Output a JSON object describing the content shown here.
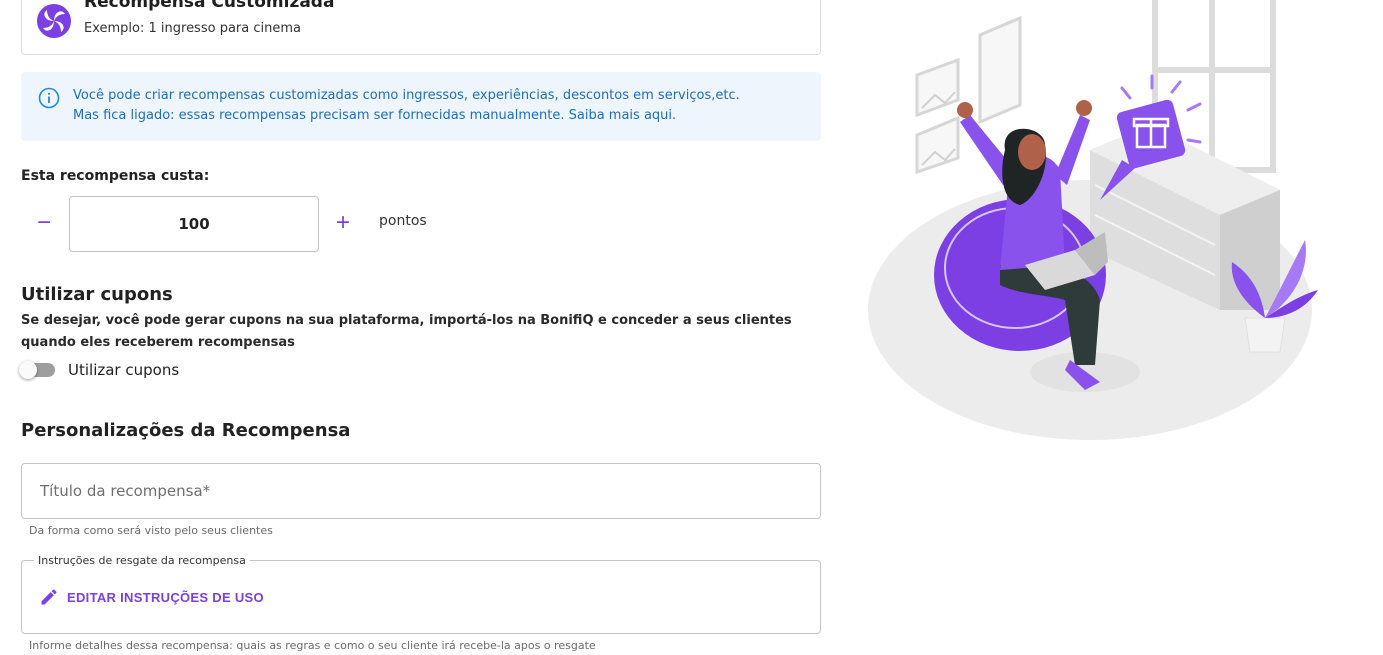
{
  "reward": {
    "title": "Recompensa Customizada",
    "subtitle": "Exemplo: 1 ingresso para cinema"
  },
  "info": {
    "line1": "Você pode criar recompensas customizadas como ingressos, experiências, descontos em serviços,etc.",
    "line2": "Mas fica ligado: essas recompensas precisam ser fornecidas manualmente. Saiba mais aqui."
  },
  "cost": {
    "label": "Esta recompensa custa:",
    "value": "100",
    "unit": "pontos",
    "minus": "−",
    "plus": "+"
  },
  "coupons": {
    "title": "Utilizar cupons",
    "description": "Se desejar, você pode gerar cupons na sua plataforma, importá-los na BonifiQ e conceder a seus clientes quando eles receberem recompensas",
    "toggle_label": "Utilizar cupons",
    "toggle_on": false
  },
  "personalization": {
    "title": "Personalizações da Recompensa",
    "title_placeholder": "Título da recompensa*",
    "title_helper": "Da forma como será visto pelo seus clientes",
    "instructions_legend": "Instruções de resgate da recompensa",
    "edit_button": "EDITAR INSTRUÇÕES DE USO",
    "instructions_helper": "Informe detalhes dessa recompensa: quais as regras e como o seu cliente irá recebe-la apos o resgate"
  },
  "colors": {
    "accent": "#7b3fe4",
    "info_bg": "#eef5fd",
    "info_text": "#1c6fb8"
  }
}
